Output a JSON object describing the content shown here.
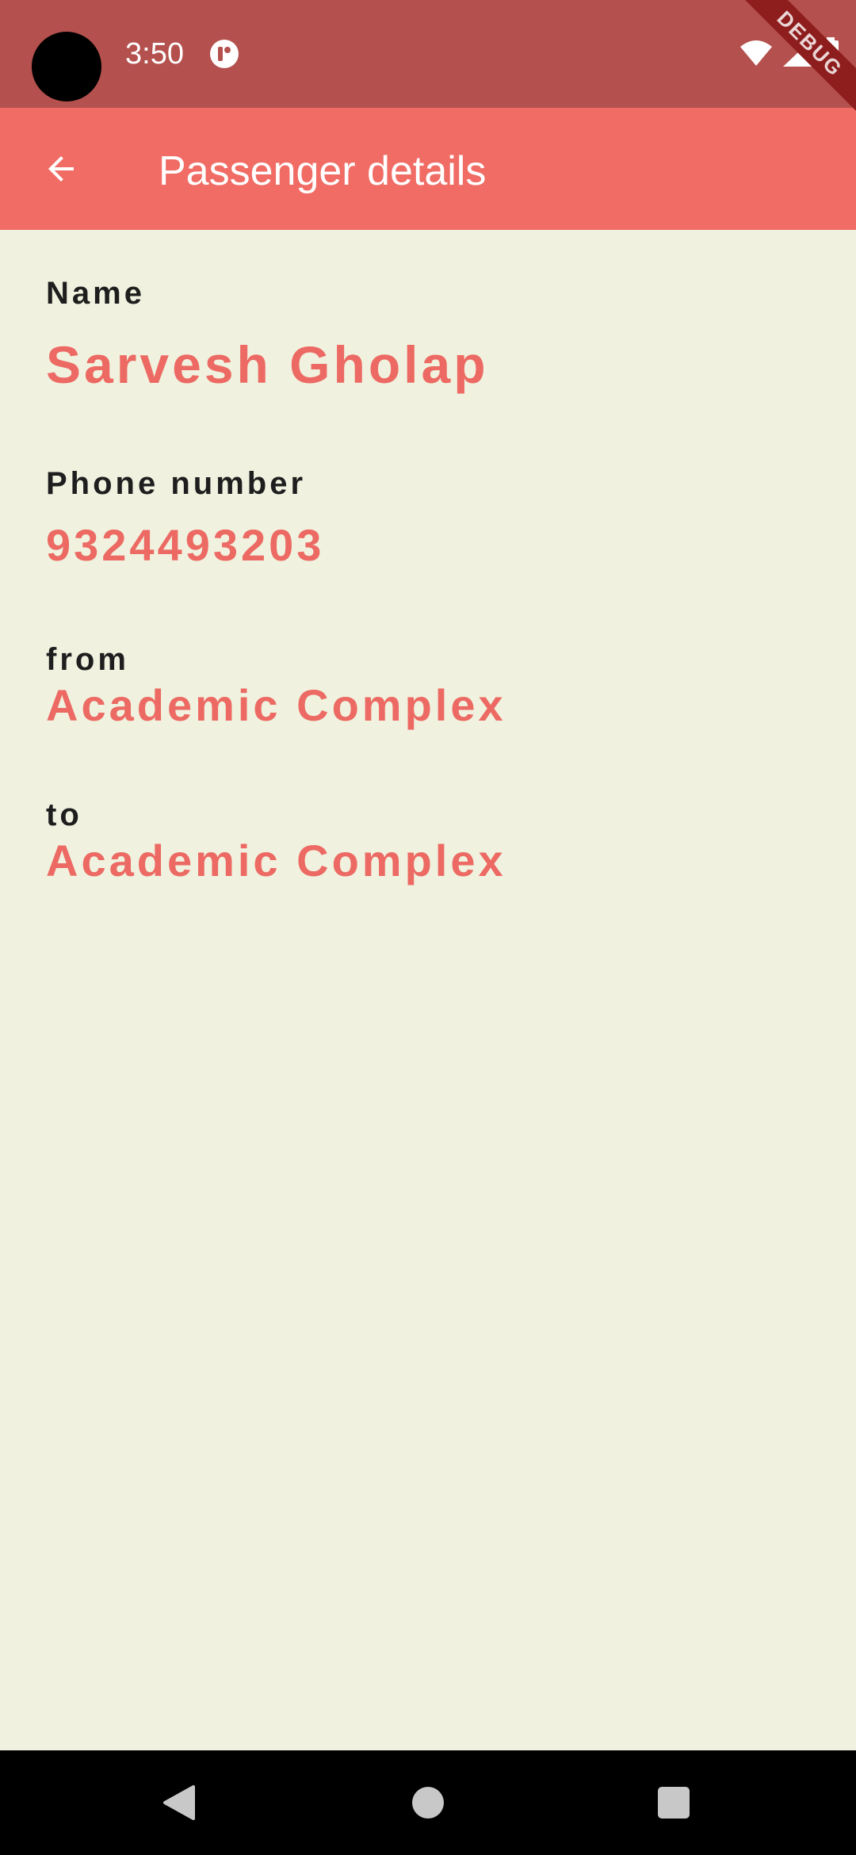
{
  "status_bar": {
    "time": "3:50"
  },
  "app_bar": {
    "title": "Passenger details"
  },
  "debug_banner": "DEBUG",
  "fields": {
    "name": {
      "label": "Name",
      "value": "Sarvesh Gholap"
    },
    "phone": {
      "label": "Phone number",
      "value": "9324493203"
    },
    "from": {
      "label": "from",
      "value": "Academic Complex"
    },
    "to": {
      "label": "to",
      "value": "Academic Complex"
    }
  },
  "colors": {
    "status_bar": "#B4504D",
    "app_bar": "#F06C65",
    "background": "#F0F2DF",
    "accent_text": "#EC6A63",
    "label_text": "#1E1E1E",
    "nav_bar": "#000000"
  },
  "icons": {
    "back": "arrow-back-icon",
    "wifi": "wifi-icon",
    "signal": "cell-signal-icon",
    "battery": "battery-icon",
    "app_notification": "app-notification-icon",
    "nav_back": "triangle-back-icon",
    "nav_home": "circle-home-icon",
    "nav_recents": "square-recents-icon"
  }
}
